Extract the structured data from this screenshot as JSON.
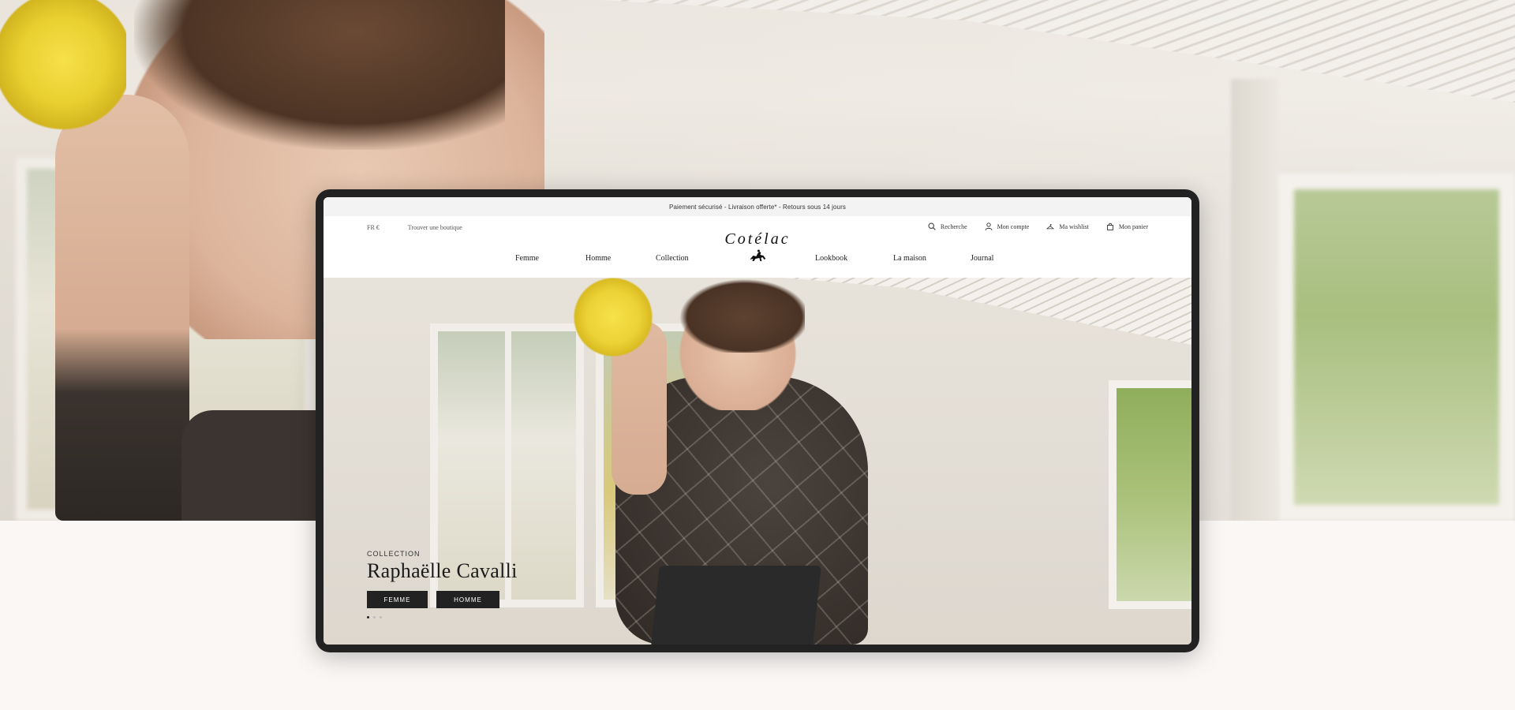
{
  "topbar": {
    "notice": "Paiement sécurisé - Livraison offerte* - Retours sous 14 jours"
  },
  "header": {
    "locale": "FR €",
    "find_store": "Trouver une boutique",
    "logo_text": "Cotélac",
    "utility": [
      {
        "icon": "search-icon",
        "label": "Recherche"
      },
      {
        "icon": "user-icon",
        "label": "Mon compte"
      },
      {
        "icon": "hanger-icon",
        "label": "Ma wishlist"
      },
      {
        "icon": "bag-icon",
        "label": "Mon panier"
      }
    ]
  },
  "nav": {
    "items": [
      "Femme",
      "Homme",
      "Collection",
      "Lookbook",
      "La maison",
      "Journal"
    ]
  },
  "hero": {
    "eyebrow": "COLLECTION",
    "title": "Raphaëlle Cavalli",
    "cta_femme": "FEMME",
    "cta_homme": "HOMME",
    "slides": 3,
    "active_slide": 1
  },
  "colors": {
    "frame": "#222222",
    "button": "#222222",
    "page_bg": "#faf7f5",
    "topbar_bg": "#f3f3f3"
  }
}
